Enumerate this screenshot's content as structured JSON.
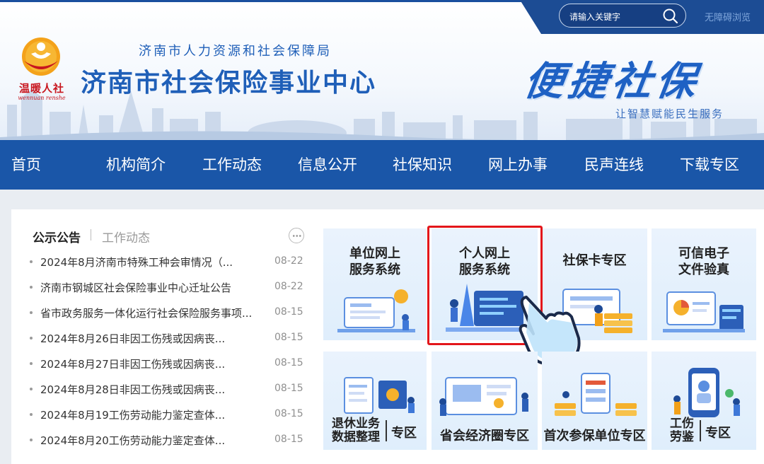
{
  "header": {
    "bureau_name": "济南市人力资源和社会保障局",
    "center_name": "济南市社会保险事业中心",
    "logo_text": "温暖人社",
    "logo_sub": "wennuan renshe",
    "slogan": "便捷社保",
    "slogan_sub": "让智慧赋能民生服务",
    "search_placeholder": "请输入关键字",
    "accessibility_link": "无障碍浏览"
  },
  "nav": {
    "items": [
      "首页",
      "机构简介",
      "工作动态",
      "信息公开",
      "社保知识",
      "网上办事",
      "民声连线",
      "下载专区"
    ]
  },
  "news": {
    "tab_active": "公示公告",
    "tab_inactive": "工作动态",
    "items": [
      {
        "title": "2024年8月济南市特殊工种会审情况（...",
        "date": "08-22"
      },
      {
        "title": "济南市钢城区社会保险事业中心迁址公告",
        "date": "08-22"
      },
      {
        "title": "省市政务服务一体化运行社会保险服务事项...",
        "date": "08-15"
      },
      {
        "title": "2024年8月26日非因工伤残或因病丧...",
        "date": "08-15"
      },
      {
        "title": "2024年8月27日非因工伤残或因病丧...",
        "date": "08-15"
      },
      {
        "title": "2024年8月28日非因工伤残或因病丧...",
        "date": "08-15"
      },
      {
        "title": "2024年8月19工伤劳动能力鉴定查体...",
        "date": "08-15"
      },
      {
        "title": "2024年8月20工伤劳动能力鉴定查体...",
        "date": "08-15"
      }
    ]
  },
  "services": {
    "top": [
      {
        "line1": "单位网上",
        "line2": "服务系统"
      },
      {
        "line1": "个人网上",
        "line2": "服务系统"
      },
      {
        "line1": "社保卡专区",
        "line2": ""
      },
      {
        "line1": "可信电子",
        "line2": "文件验真"
      }
    ],
    "bottom": {
      "retire_a": "退休业务",
      "retire_b": "数据整理",
      "retire_suffix": "专区",
      "economic": "省会经济圈专区",
      "first_unit": "首次参保单位专区",
      "injury_a": "工伤",
      "injury_b": "劳鉴",
      "injury_suffix": "专区"
    }
  },
  "colors": {
    "primary_blue": "#1a56a8",
    "highlight_red": "#e3161b",
    "title_blue": "#1f5fb8"
  }
}
